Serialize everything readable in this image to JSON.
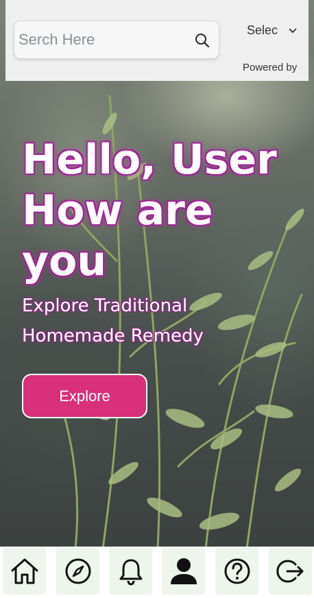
{
  "search": {
    "placeholder": "Serch Here"
  },
  "language_select": {
    "label": "Selec"
  },
  "powered_by": "Powered by",
  "hero": {
    "title_lines": [
      "Hello, User",
      "How are",
      "you"
    ],
    "subtitle_lines": [
      "Explore Traditional",
      "Homemade Remedy"
    ],
    "button_label": "Explore"
  },
  "colors": {
    "accent": "#d8307a",
    "title_outline": "#a02595",
    "nav_bg": "#eef5ec"
  },
  "bottom_nav": [
    {
      "name": "home",
      "icon": "home-icon"
    },
    {
      "name": "explore",
      "icon": "compass-icon"
    },
    {
      "name": "notifications",
      "icon": "bell-icon"
    },
    {
      "name": "profile",
      "icon": "user-icon"
    },
    {
      "name": "help",
      "icon": "help-icon"
    },
    {
      "name": "logout",
      "icon": "logout-icon"
    }
  ]
}
